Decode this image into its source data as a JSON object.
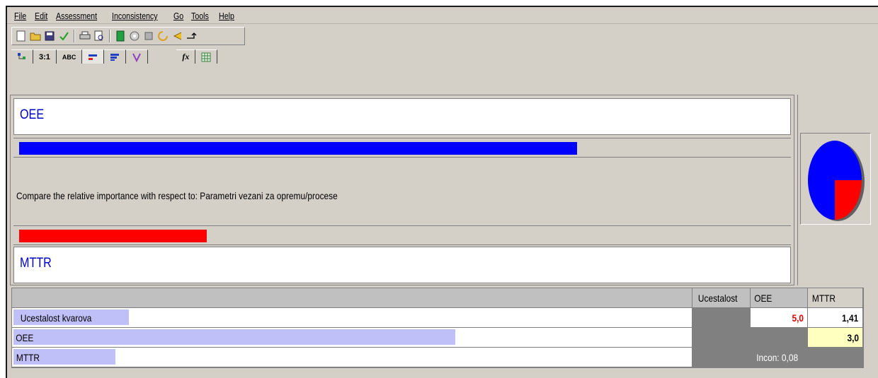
{
  "menu": [
    {
      "label": "File"
    },
    {
      "label": "Edit"
    },
    {
      "label": "Assessment"
    },
    {
      "label": "Inconsistency"
    },
    {
      "label": "Go"
    },
    {
      "label": "Tools"
    },
    {
      "label": "Help"
    }
  ],
  "toolbar_icons": [
    "new-file-icon",
    "open-folder-icon",
    "save-icon",
    "check-icon",
    "print-icon",
    "print-preview-icon",
    "calculator-icon",
    "settings-icon",
    "tools-icon",
    "refresh-icon",
    "back-icon",
    "goto-icon"
  ],
  "tabs": [
    {
      "label": "",
      "icon": "tree-icon"
    },
    {
      "label": "3:1"
    },
    {
      "label": "ABC"
    },
    {
      "label": "",
      "icon": "bar-red-icon",
      "active": true
    },
    {
      "label": "",
      "icon": "bar-blue-icon"
    },
    {
      "label": "",
      "icon": "hierarchy-icon"
    },
    {
      "label": "fx"
    },
    {
      "label": "",
      "icon": "grid-icon"
    }
  ],
  "comparison": {
    "top_name": "OEE",
    "bottom_name": "MTTR",
    "question": "Compare the relative importance with respect to: Parametri vezani za opremu/procese",
    "top_level": 0.73,
    "bottom_level": 0.245,
    "colors": {
      "top": "#0000ff",
      "bottom": "#ff0000"
    }
  },
  "pie": {
    "slices": [
      {
        "name": "OEE",
        "value": 0.75,
        "color": "#0000ff"
      },
      {
        "name": "MTTR",
        "value": 0.25,
        "color": "#ff0000"
      }
    ]
  },
  "grid": {
    "headers": [
      "Ucestalost",
      "OEE",
      "MTTR"
    ],
    "rows": [
      {
        "name": "Ucestalost kvarova",
        "level": 0.17,
        "c1": "",
        "c2": "5,0",
        "c3": "1,41"
      },
      {
        "name": "OEE",
        "level": 0.65,
        "c1": "",
        "c2": "",
        "c3": "3,0"
      },
      {
        "name": "MTTR",
        "level": 0.15,
        "c1": "",
        "c2": "Incon: 0,08",
        "c3": ""
      }
    ]
  }
}
